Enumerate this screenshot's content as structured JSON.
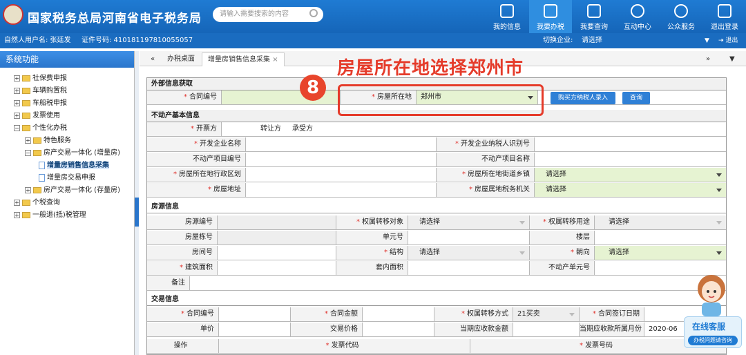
{
  "header": {
    "site_title": "国家税务总局河南省电子税务局",
    "search_placeholder": "请输入需要搜索的内容",
    "nav": [
      {
        "label": "我的信息",
        "icon": "user-icon"
      },
      {
        "label": "我要办税",
        "icon": "monitor-icon"
      },
      {
        "label": "我要查询",
        "icon": "search-doc-icon"
      },
      {
        "label": "互动中心",
        "icon": "chat-icon"
      },
      {
        "label": "公众服务",
        "icon": "service-icon"
      },
      {
        "label": "退出登录",
        "icon": "logout-icon"
      }
    ]
  },
  "userbar": {
    "user": "自然人用户名: 张廷发",
    "id": "证件号码: 410181197810055057",
    "switch": "切换企业:",
    "switch_value": "请选择"
  },
  "sidebar": {
    "title": "系统功能",
    "items": [
      {
        "label": "社保费申报",
        "kind": "plus"
      },
      {
        "label": "车辆购置税",
        "kind": "plus"
      },
      {
        "label": "车船税申报",
        "kind": "plus"
      },
      {
        "label": "发票使用",
        "kind": "plus"
      },
      {
        "label": "个性化办税",
        "kind": "minus"
      },
      {
        "label": "特色服务",
        "kind": "plus"
      },
      {
        "label": "房产交易一体化 (增量房)",
        "kind": "minus"
      },
      {
        "label": "增量房销售信息采集",
        "kind": "doc"
      },
      {
        "label": "增量房交易申报",
        "kind": "doc"
      },
      {
        "label": "房产交易一体化 (存量房)",
        "kind": "plus"
      },
      {
        "label": "个税查询",
        "kind": "plus"
      },
      {
        "label": "一般退(抵)税管理",
        "kind": "plus"
      }
    ]
  },
  "tabs": {
    "home": "办税桌面",
    "active": "增量房销售信息采集",
    "left_arrows": "«",
    "right_arrows": "»",
    "more": "▼"
  },
  "annotation": {
    "text": "房屋所在地选择郑州市",
    "step": "8"
  },
  "form": {
    "sec_external": "外部信息获取",
    "contract_no": "合同编号",
    "location": "房屋所在地",
    "location_value": "郑州市",
    "btn_buyer": "购买方纳税人录入",
    "btn_query": "查询",
    "sec_property": "不动产基本信息",
    "issuer": "开票方",
    "issuer_opt1": "转让方",
    "issuer_opt2": "承受方",
    "developer_name": "开发企业名称",
    "developer_id": "开发企业纳税人识别号",
    "project_no": "不动产项目编号",
    "project_name": "不动产项目名称",
    "district": "房屋所在地行政区划",
    "street": "房屋所在地街道乡镇",
    "address": "房屋地址",
    "tax_office": "房屋属地税务机关",
    "please_select": "请选择",
    "sec_source": "房源信息",
    "source_no": "房源编号",
    "transfer_object": "权属转移对象",
    "transfer_use": "权属转移用途",
    "building_no": "房屋栋号",
    "unit_no": "单元号",
    "floor": "楼层",
    "room_no": "房间号",
    "structure": "结构",
    "orientation": "朝向",
    "build_area": "建筑面积",
    "inner_area": "套内面积",
    "unit_code": "不动产单元号",
    "remark": "备注",
    "sec_trade": "交易信息",
    "trade_contract_no": "合同编号",
    "contract_amount": "合同金额",
    "transfer_method": "权属转移方式",
    "transfer_method_value": "21买卖",
    "sign_date": "合同签订日期",
    "unit_price": "单价",
    "trade_price": "交易价格",
    "current_receivable": "当期应收款金额",
    "current_month": "当期应收款所属月份",
    "current_month_value": "2020-06",
    "op": "操作",
    "invoice_code": "发票代码",
    "invoice_no": "发票号码"
  },
  "service": {
    "title": "在线客服",
    "sub": "办税问题请咨询"
  }
}
